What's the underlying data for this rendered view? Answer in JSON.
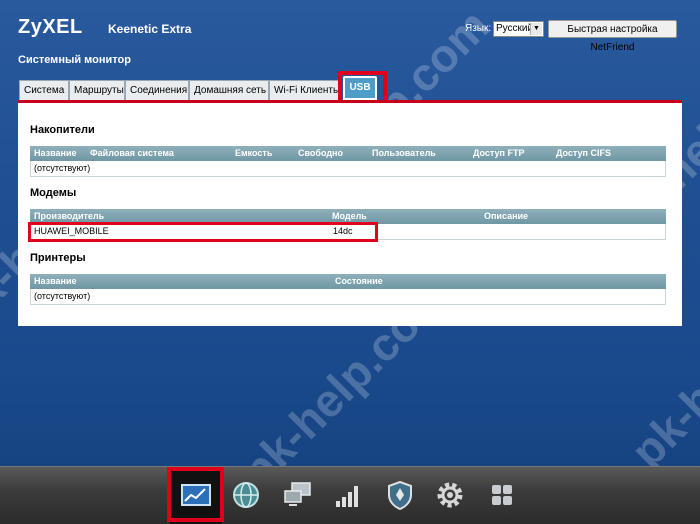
{
  "header": {
    "brand": "ZyXEL",
    "model": "Keenetic Extra",
    "language_label": "Язык:",
    "language_value": "Русский",
    "netfriend_button": "Быстрая настройка NetFriend"
  },
  "page_title": "Системный монитор",
  "tabs": [
    {
      "label": "Система"
    },
    {
      "label": "Маршруты"
    },
    {
      "label": "Соединения"
    },
    {
      "label": "Домашняя сеть"
    },
    {
      "label": "Wi-Fi Клиенты"
    },
    {
      "label": "USB",
      "active": true
    }
  ],
  "storage": {
    "title": "Накопители",
    "columns": [
      "Название",
      "Файловая система",
      "Емкость",
      "Свободно",
      "Пользователь",
      "Доступ FTP",
      "Доступ CIFS"
    ],
    "empty_text": "(отсутствуют)"
  },
  "modems": {
    "title": "Модемы",
    "columns": [
      "Производитель",
      "Модель",
      "Описание"
    ],
    "rows": [
      {
        "vendor": "HUAWEI_MOBILE",
        "model": "14dc",
        "description": ""
      }
    ]
  },
  "printers": {
    "title": "Принтеры",
    "columns": [
      "Название",
      "Состояние"
    ],
    "empty_text": "(отсутствуют)"
  },
  "watermark_text": "pk-help.com",
  "dock": [
    {
      "icon": "monitor-chart-icon",
      "active": true
    },
    {
      "icon": "globe-icon"
    },
    {
      "icon": "network-computers-icon"
    },
    {
      "icon": "signal-bars-icon"
    },
    {
      "icon": "shield-icon"
    },
    {
      "icon": "gear-icon"
    },
    {
      "icon": "apps-grid-icon"
    }
  ],
  "colors": {
    "highlight": "#e1001b",
    "active_tab": "#4d9dc8",
    "table_header": "#7fa3ae"
  }
}
